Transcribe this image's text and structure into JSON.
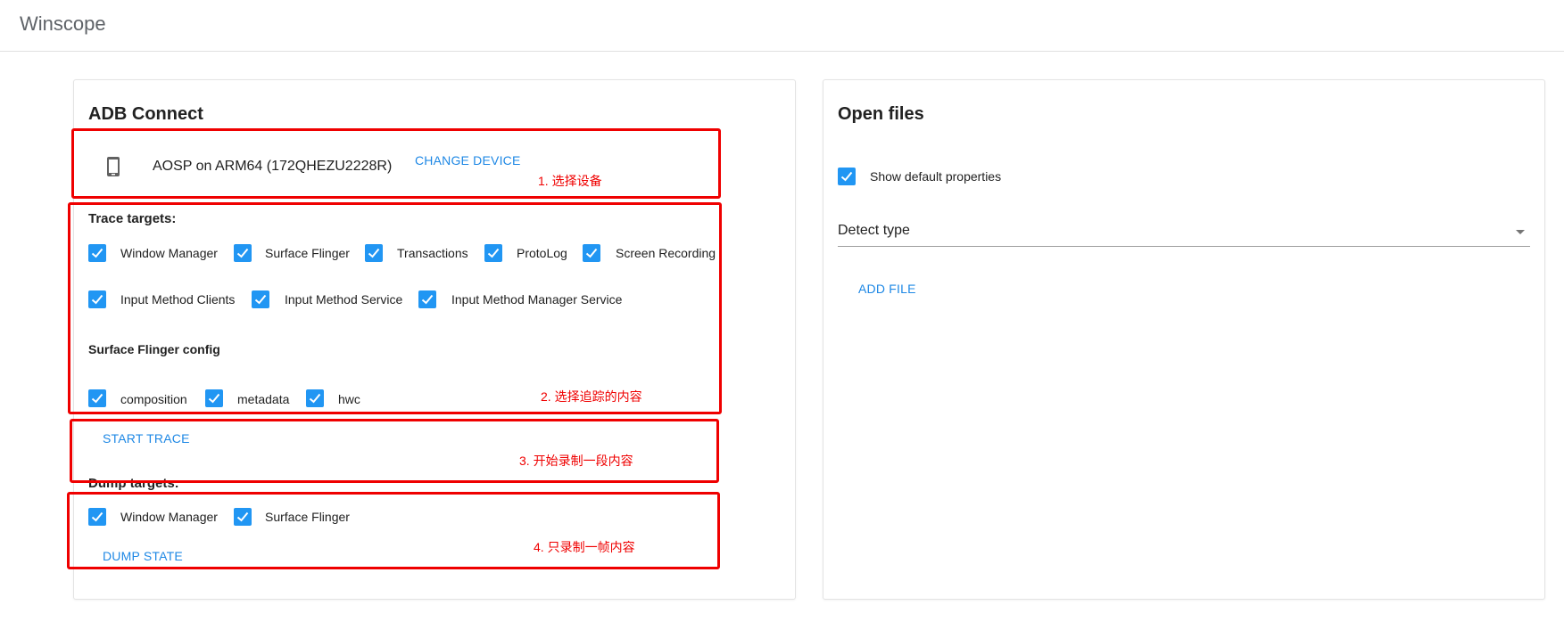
{
  "app": {
    "title": "Winscope"
  },
  "adb": {
    "title": "ADB Connect",
    "device_name": "AOSP on ARM64 (172QHEZU2228R)",
    "change_device": "CHANGE DEVICE",
    "trace_targets_label": "Trace targets:",
    "trace_targets": [
      {
        "label": "Window Manager",
        "checked": true
      },
      {
        "label": "Surface Flinger",
        "checked": true
      },
      {
        "label": "Transactions",
        "checked": true
      },
      {
        "label": "ProtoLog",
        "checked": true
      },
      {
        "label": "Screen Recording",
        "checked": true
      },
      {
        "label": "Input Method Clients",
        "checked": true
      },
      {
        "label": "Input Method Service",
        "checked": true
      },
      {
        "label": "Input Method Manager Service",
        "checked": true
      }
    ],
    "sf_config_label": "Surface Flinger config",
    "sf_config": [
      {
        "label": "composition",
        "checked": true
      },
      {
        "label": "metadata",
        "checked": true
      },
      {
        "label": "hwc",
        "checked": true
      }
    ],
    "start_trace": "START TRACE",
    "dump_targets_label": "Dump targets:",
    "dump_targets": [
      {
        "label": "Window Manager",
        "checked": true
      },
      {
        "label": "Surface Flinger",
        "checked": true
      }
    ],
    "dump_state": "DUMP STATE"
  },
  "open_files": {
    "title": "Open files",
    "show_default_label": "Show default properties",
    "show_default_checked": true,
    "detect_type": "Detect type",
    "add_file": "ADD FILE"
  },
  "annotations": {
    "note1": "1. 选择设备",
    "note2": "2. 选择追踪的内容",
    "note3": "3. 开始录制一段内容",
    "note4": "4. 只录制一帧内容"
  },
  "colors": {
    "accent": "#1e88e5",
    "checkbox": "#2196f3",
    "annotation": "#ef0000"
  },
  "icons": {
    "device": "smartphone-icon",
    "dropdown": "caret-down-icon",
    "check": "checkmark-icon"
  }
}
